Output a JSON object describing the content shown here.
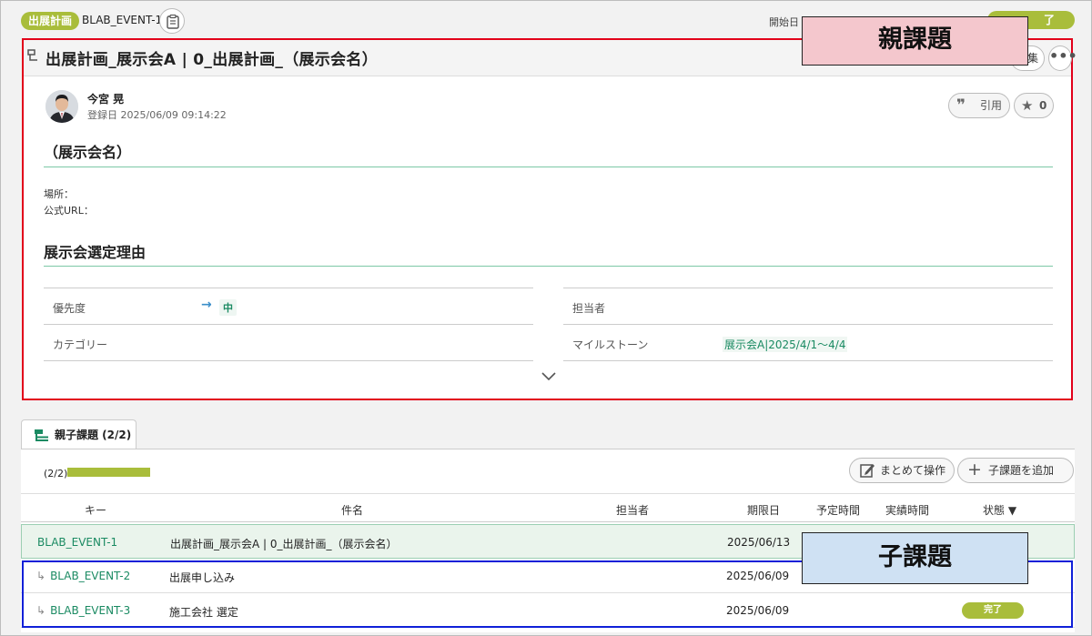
{
  "top": {
    "category": "出展計画",
    "issue_key": "BLAB_EVENT-1",
    "start_label": "開始日",
    "status": "了"
  },
  "parent": {
    "title": "出展計画_展示会A | 0_出展計画_（展示会名）",
    "edit_label": "集",
    "more_label": "•••",
    "author": "今宮 晃",
    "created": "登録日 2025/06/09 09:14:22",
    "quote_label": "引用",
    "star_count": "0",
    "heading1": "（展示会名）",
    "line_place": "場所：",
    "line_url": "公式URL：",
    "heading2": "展示会選定理由",
    "props": {
      "priority_label": "優先度",
      "priority_value": "中",
      "assignee_label": "担当者",
      "category_label": "カテゴリー",
      "milestone_label": "マイルストーン",
      "milestone_value": "展示会A|2025/4/1〜4/4"
    }
  },
  "annotations": {
    "parent_label": "親課題",
    "child_label": "子課題"
  },
  "children": {
    "tab_label": "親子課題 (2/2)",
    "progress_text": "(2/2)",
    "progress_fraction": 1.0,
    "batch_label": "まとめて操作",
    "add_label": "子課題を追加",
    "columns": {
      "key": "キー",
      "summary": "件名",
      "assignee": "担当者",
      "due": "期限日",
      "planned": "予定時間",
      "actual": "実績時間",
      "status": "状態 ▼"
    },
    "rows": [
      {
        "key": "BLAB_EVENT-1",
        "summary": "出展計画_展示会A | 0_出展計画_（展示会名）",
        "due": "2025/06/13",
        "status": ""
      },
      {
        "key": "BLAB_EVENT-2",
        "summary": "出展申し込み",
        "due": "2025/06/09",
        "status": ""
      },
      {
        "key": "BLAB_EVENT-3",
        "summary": "施工会社 選定",
        "due": "2025/06/09",
        "status": "完了"
      }
    ]
  },
  "colors": {
    "accent_green": "#a9bd3b",
    "link_green": "#1a8a62",
    "parent_box": "#e2001a",
    "child_box": "#1020d8"
  }
}
